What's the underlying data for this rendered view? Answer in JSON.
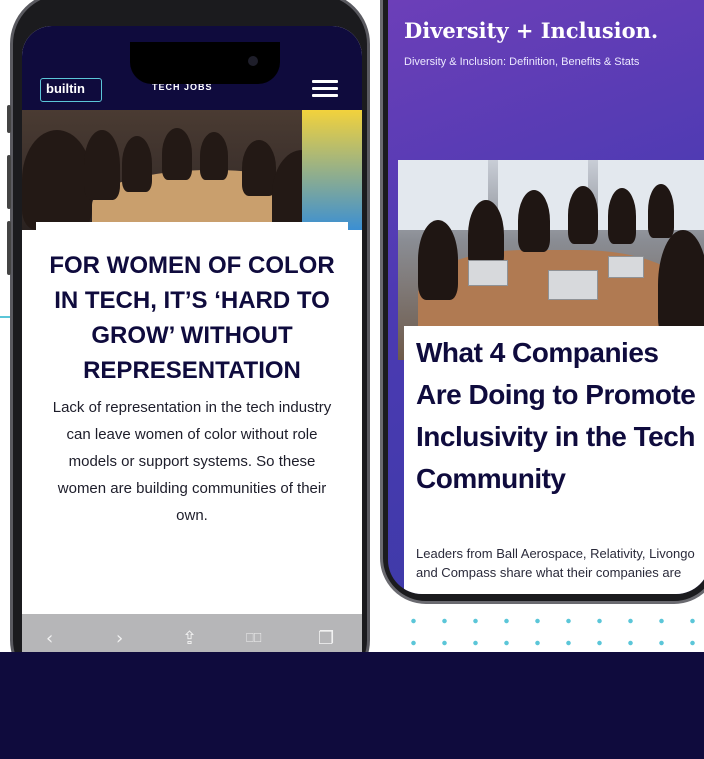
{
  "phone1": {
    "nav": {
      "logo": "builtin",
      "title": "TECH JOBS"
    },
    "article": {
      "headline": "FOR WOMEN OF COLOR IN TECH, IT’S ‘HARD TO GROW’ WITHOUT REPRESENTATION",
      "body": "Lack of representation in the tech industry can leave women of color without role models or support systems. So these women are building communities of their own."
    },
    "toolbar": {
      "back_icon": "‹",
      "forward_icon": "›",
      "share_icon": "⇪",
      "bookmarks_icon": "⎕⎕",
      "tabs_icon": "❐"
    }
  },
  "phone2": {
    "title": "Diversity + Inclusion.",
    "subtitle": "Diversity & Inclusion: Definition, Benefits & Stats",
    "article": {
      "headline": "What 4 Companies Are Doing to Promote Inclusivity in the Tech Community",
      "body": "Leaders from Ball Aerospace, Relativity, Livongo and Compass share what their companies are"
    }
  },
  "colors": {
    "navy": "#0f0b3d",
    "accent": "#5bc6d8",
    "purple": "#6c3fb8"
  }
}
